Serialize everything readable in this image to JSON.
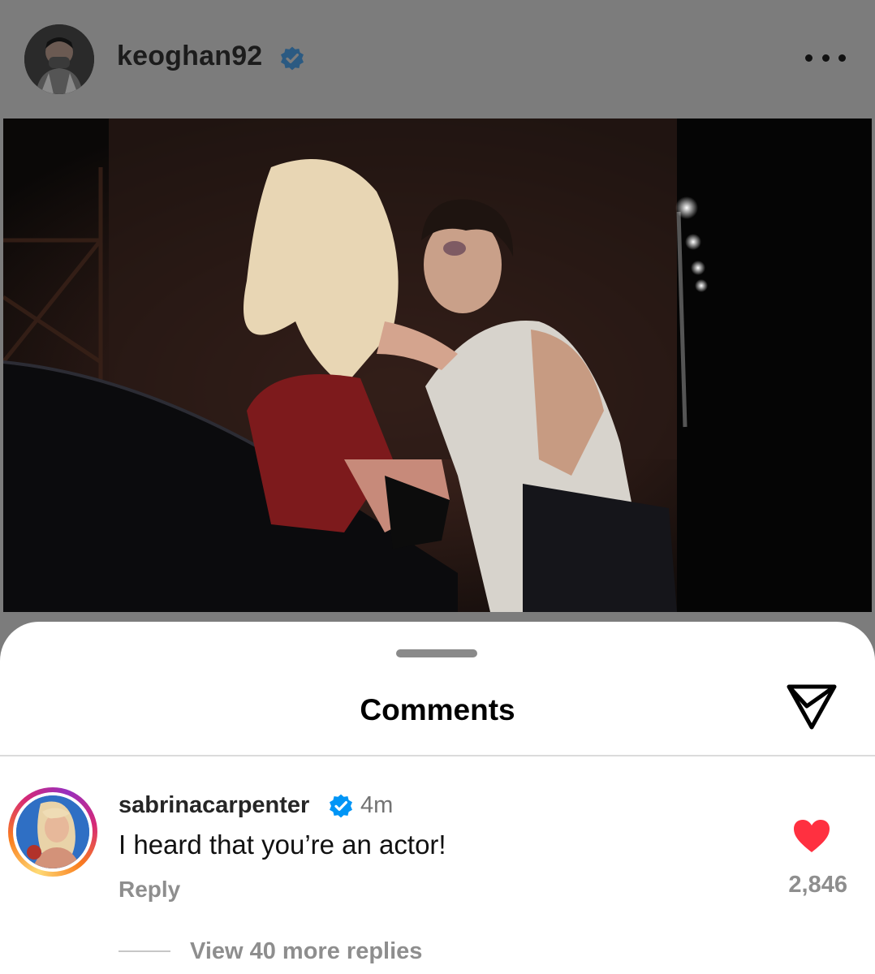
{
  "post": {
    "username": "keoghan92",
    "verified": true,
    "more_icon": "more-horizontal-icon"
  },
  "comments_sheet": {
    "title": "Comments",
    "share_icon": "paper-plane-icon"
  },
  "comment": {
    "username": "sabrinacarpenter",
    "verified": true,
    "time": "4m",
    "text": "I heard that you’re an actor!",
    "reply_label": "Reply",
    "like_count": "2,846",
    "liked": true,
    "view_replies_label": "View 40 more replies"
  },
  "colors": {
    "dim_overlay": "#7c7c7c",
    "verified_blue": "#0095f6",
    "like_red": "#ff3040",
    "muted_text": "#8e8e8e"
  }
}
